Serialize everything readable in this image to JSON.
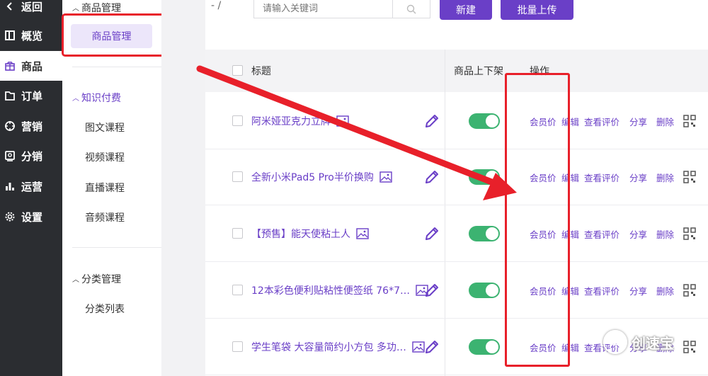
{
  "sidebar": {
    "items": [
      {
        "label": "返回",
        "icon": "back-chevron-icon"
      },
      {
        "label": "概览",
        "icon": "overview-icon"
      },
      {
        "label": "商品",
        "icon": "product-icon"
      },
      {
        "label": "订单",
        "icon": "order-icon"
      },
      {
        "label": "营销",
        "icon": "marketing-icon"
      },
      {
        "label": "分销",
        "icon": "distribution-icon"
      },
      {
        "label": "运营",
        "icon": "operations-icon"
      },
      {
        "label": "设置",
        "icon": "settings-icon"
      }
    ],
    "active_index": 2
  },
  "submenu": {
    "group1_title": "商品管理",
    "active_item": "商品管理",
    "group2_title": "知识付费",
    "group2_items": [
      "图文课程",
      "视频课程",
      "直播课程",
      "音频课程"
    ],
    "group3_title": "分类管理",
    "group3_items": [
      "分类列表"
    ]
  },
  "toolbar": {
    "search_placeholder": "请输入关键词",
    "new_label": "新建",
    "batch_upload_label": "批量上传"
  },
  "table": {
    "headers": {
      "title": "标题",
      "status": "商品上下架",
      "actions": "操作"
    },
    "action_labels": [
      "会员价",
      "编辑",
      "查看评价",
      "分享",
      "删除"
    ],
    "rows": [
      {
        "title": "阿米娅亚克力立牌",
        "on_sale": true
      },
      {
        "title": "全新小米Pad5 Pro半价换购",
        "on_sale": true
      },
      {
        "title": "【预售】能天使粘土人",
        "on_sale": true
      },
      {
        "title": "12本彩色便利贴粘性便签纸 76*7…",
        "on_sale": true
      },
      {
        "title": "学生笔袋 大容量简约小方包 多功…",
        "on_sale": true
      }
    ]
  },
  "watermark": {
    "text": "创速宝"
  },
  "colors": {
    "accent": "#6a3fc7",
    "toggle_on": "#3cb371",
    "highlight": "#e8202a",
    "sidebar_bg": "#2b2d31"
  }
}
